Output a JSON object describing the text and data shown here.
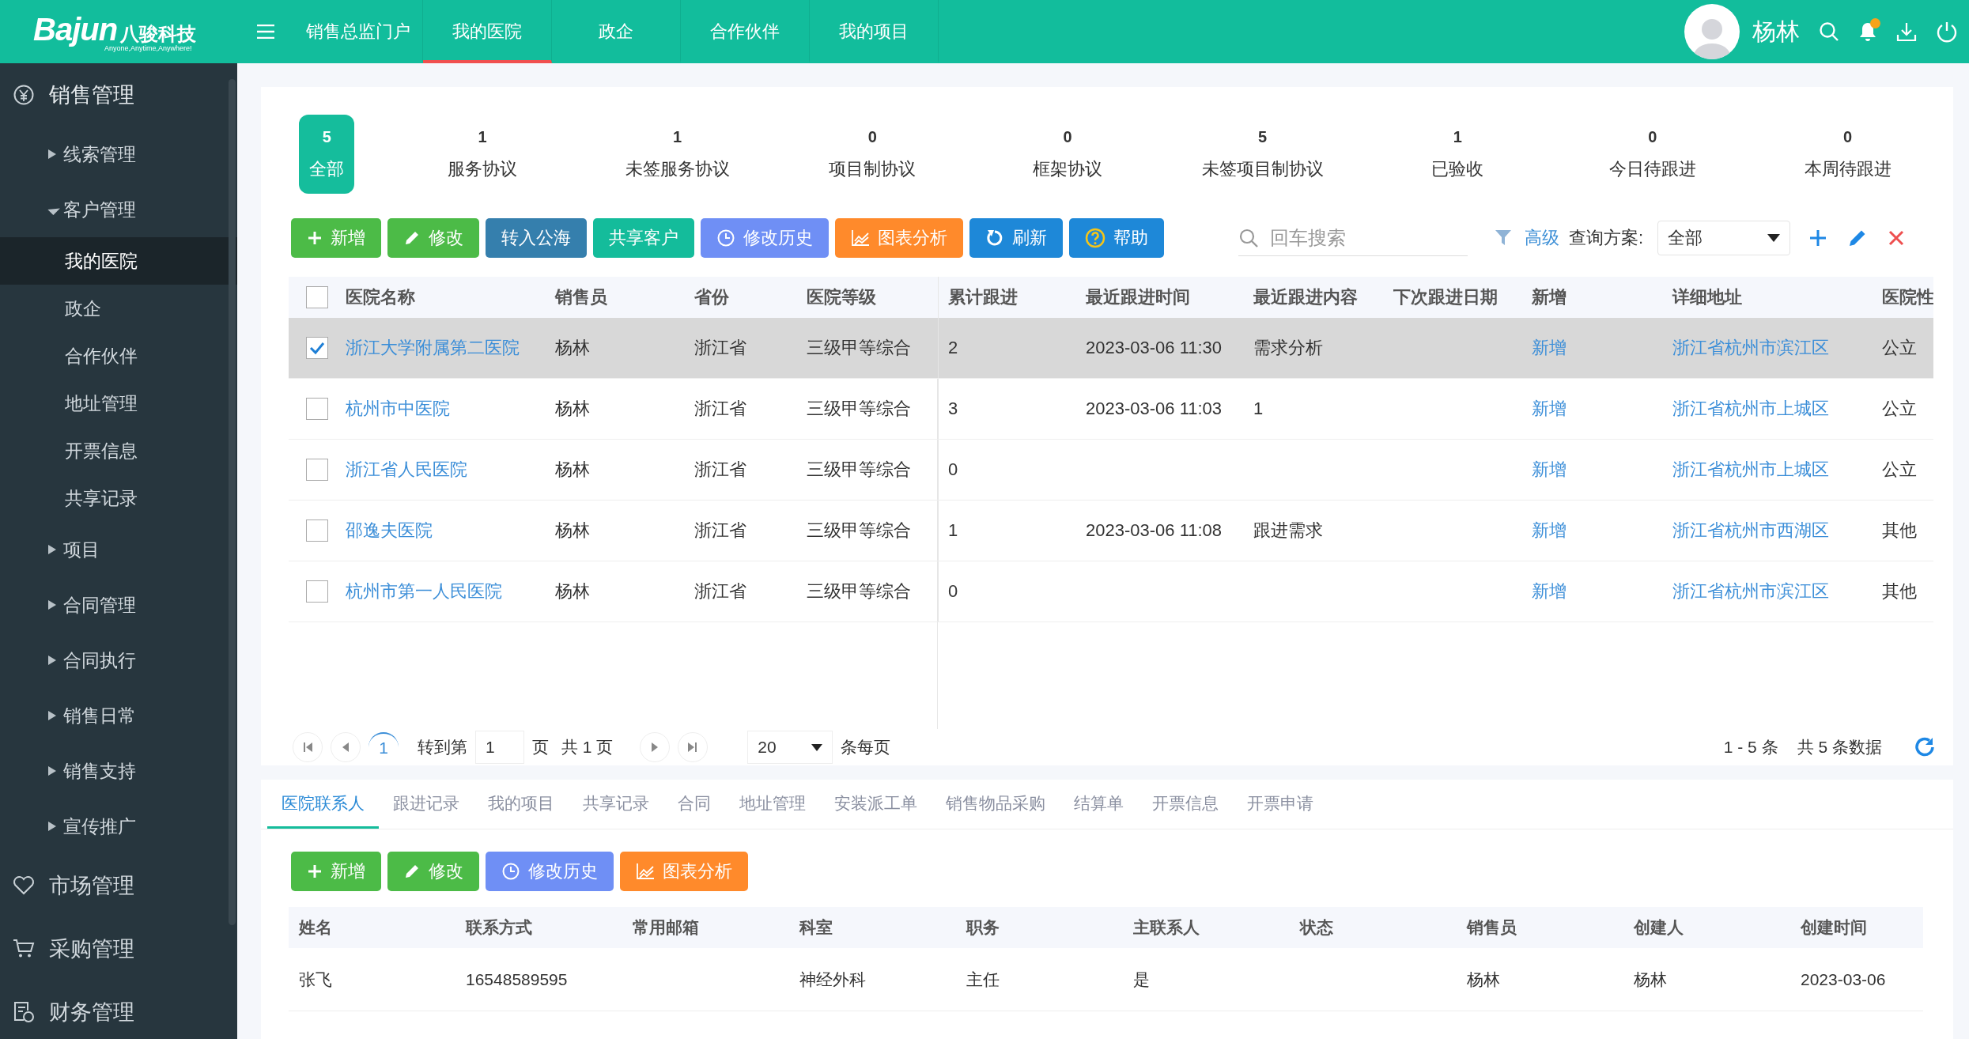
{
  "header": {
    "logo": {
      "brand": "Bajun",
      "name": "八骏科技",
      "slogan": "Anyone,Anytime,Anywhere!"
    },
    "nav": [
      {
        "label": "销售总监门户",
        "selected": false
      },
      {
        "label": "我的医院",
        "selected": true
      },
      {
        "label": "政企",
        "selected": false
      },
      {
        "label": "合作伙伴",
        "selected": false
      },
      {
        "label": "我的项目",
        "selected": false
      }
    ],
    "user": {
      "name": "杨林"
    },
    "notification_dot": true
  },
  "sidebar": {
    "groups": [
      {
        "label": "销售管理",
        "expanded": true,
        "children": [
          {
            "label": "线索管理",
            "expanded": false
          },
          {
            "label": "客户管理",
            "expanded": true,
            "children": [
              {
                "label": "我的医院",
                "selected": true
              },
              {
                "label": "政企",
                "selected": false
              },
              {
                "label": "合作伙伴",
                "selected": false
              },
              {
                "label": "地址管理",
                "selected": false
              },
              {
                "label": "开票信息",
                "selected": false
              },
              {
                "label": "共享记录",
                "selected": false
              }
            ]
          },
          {
            "label": "项目",
            "expanded": false
          },
          {
            "label": "合同管理",
            "expanded": false
          },
          {
            "label": "合同执行",
            "expanded": false
          },
          {
            "label": "销售日常",
            "expanded": false
          },
          {
            "label": "销售支持",
            "expanded": false
          },
          {
            "label": "宣传推广",
            "expanded": false
          }
        ]
      },
      {
        "label": "市场管理",
        "expanded": false
      },
      {
        "label": "采购管理",
        "expanded": false
      },
      {
        "label": "财务管理",
        "expanded": false
      }
    ]
  },
  "stats": [
    {
      "count": "5",
      "label": "全部",
      "selected": true
    },
    {
      "count": "1",
      "label": "服务协议",
      "selected": false
    },
    {
      "count": "1",
      "label": "未签服务协议",
      "selected": false
    },
    {
      "count": "0",
      "label": "项目制协议",
      "selected": false
    },
    {
      "count": "0",
      "label": "框架协议",
      "selected": false
    },
    {
      "count": "5",
      "label": "未签项目制协议",
      "selected": false
    },
    {
      "count": "1",
      "label": "已验收",
      "selected": false
    },
    {
      "count": "0",
      "label": "今日待跟进",
      "selected": false
    },
    {
      "count": "0",
      "label": "本周待跟进",
      "selected": false
    }
  ],
  "toolbar": {
    "buttons": [
      {
        "label": "新增",
        "kind": "add",
        "color": "#4cbb47"
      },
      {
        "label": "修改",
        "kind": "edit",
        "color": "#4cbb47"
      },
      {
        "label": "转入公海",
        "kind": "plain",
        "color": "#357fad"
      },
      {
        "label": "共享客户",
        "kind": "plain",
        "color": "#14bc9b"
      },
      {
        "label": "修改历史",
        "kind": "history",
        "color": "#6f8ff5"
      },
      {
        "label": "图表分析",
        "kind": "chart",
        "color": "#ff8a2b"
      },
      {
        "label": "刷新",
        "kind": "refresh",
        "color": "#1e88d8"
      },
      {
        "label": "帮助",
        "kind": "help",
        "color": "#1e88d8"
      }
    ],
    "search": {
      "placeholder": "回车搜索"
    },
    "advanced": "高级",
    "scheme_label": "查询方案:",
    "scheme_value": "全部"
  },
  "table": {
    "all_checked": false,
    "columns": [
      {
        "label": "医院名称",
        "kind": "link"
      },
      {
        "label": "销售员",
        "kind": "text"
      },
      {
        "label": "省份",
        "kind": "text"
      },
      {
        "label": "医院等级",
        "kind": "text"
      },
      {
        "label": "累计跟进",
        "kind": "text"
      },
      {
        "label": "最近跟进时间",
        "kind": "text"
      },
      {
        "label": "最近跟进内容",
        "kind": "text"
      },
      {
        "label": "下次跟进日期",
        "kind": "text"
      },
      {
        "label": "新增",
        "kind": "link"
      },
      {
        "label": "详细地址",
        "kind": "link"
      },
      {
        "label": "医院性",
        "kind": "text"
      }
    ],
    "rows": [
      {
        "checked": true,
        "selected": true,
        "cells": [
          "浙江大学附属第二医院",
          "杨林",
          "浙江省",
          "三级甲等综合",
          "2",
          "2023-03-06 11:30",
          "需求分析",
          "",
          "新增",
          "浙江省杭州市滨江区",
          "公立"
        ]
      },
      {
        "checked": false,
        "selected": false,
        "cells": [
          "杭州市中医院",
          "杨林",
          "浙江省",
          "三级甲等综合",
          "3",
          "2023-03-06 11:03",
          "1",
          "",
          "新增",
          "浙江省杭州市上城区",
          "公立"
        ]
      },
      {
        "checked": false,
        "selected": false,
        "cells": [
          "浙江省人民医院",
          "杨林",
          "浙江省",
          "三级甲等综合",
          "0",
          "",
          "",
          "",
          "新增",
          "浙江省杭州市上城区",
          "公立"
        ]
      },
      {
        "checked": false,
        "selected": false,
        "cells": [
          "邵逸夫医院",
          "杨林",
          "浙江省",
          "三级甲等综合",
          "1",
          "2023-03-06 11:08",
          "跟进需求",
          "",
          "新增",
          "浙江省杭州市西湖区",
          "其他"
        ]
      },
      {
        "checked": false,
        "selected": false,
        "cells": [
          "杭州市第一人民医院",
          "杨林",
          "浙江省",
          "三级甲等综合",
          "0",
          "",
          "",
          "",
          "新增",
          "浙江省杭州市滨江区",
          "其他"
        ]
      }
    ]
  },
  "pager": {
    "current_page": "1",
    "goto_label": "转到第",
    "goto_value": "1",
    "page_unit": "页",
    "total_pages": "共 1 页",
    "page_size": "20",
    "page_size_label": "条每页",
    "range": "1 - 5 条",
    "total": "共 5 条数据"
  },
  "detail_tabs": [
    {
      "label": "医院联系人",
      "selected": true
    },
    {
      "label": "跟进记录",
      "selected": false
    },
    {
      "label": "我的项目",
      "selected": false
    },
    {
      "label": "共享记录",
      "selected": false
    },
    {
      "label": "合同",
      "selected": false
    },
    {
      "label": "地址管理",
      "selected": false
    },
    {
      "label": "安装派工单",
      "selected": false
    },
    {
      "label": "销售物品采购",
      "selected": false
    },
    {
      "label": "结算单",
      "selected": false
    },
    {
      "label": "开票信息",
      "selected": false
    },
    {
      "label": "开票申请",
      "selected": false
    }
  ],
  "detail_toolbar": {
    "buttons": [
      {
        "label": "新增",
        "kind": "add",
        "color": "#4cbb47"
      },
      {
        "label": "修改",
        "kind": "edit",
        "color": "#4cbb47"
      },
      {
        "label": "修改历史",
        "kind": "history",
        "color": "#6f8ff5"
      },
      {
        "label": "图表分析",
        "kind": "chart",
        "color": "#ff8a2b"
      }
    ]
  },
  "contacts": {
    "columns": [
      "姓名",
      "联系方式",
      "常用邮箱",
      "科室",
      "职务",
      "主联系人",
      "状态",
      "销售员",
      "创建人",
      "创建时间"
    ],
    "rows": [
      [
        "张飞",
        "16548589595",
        "",
        "神经外科",
        "主任",
        "是",
        "",
        "杨林",
        "杨林",
        "2023-03-06"
      ]
    ]
  }
}
